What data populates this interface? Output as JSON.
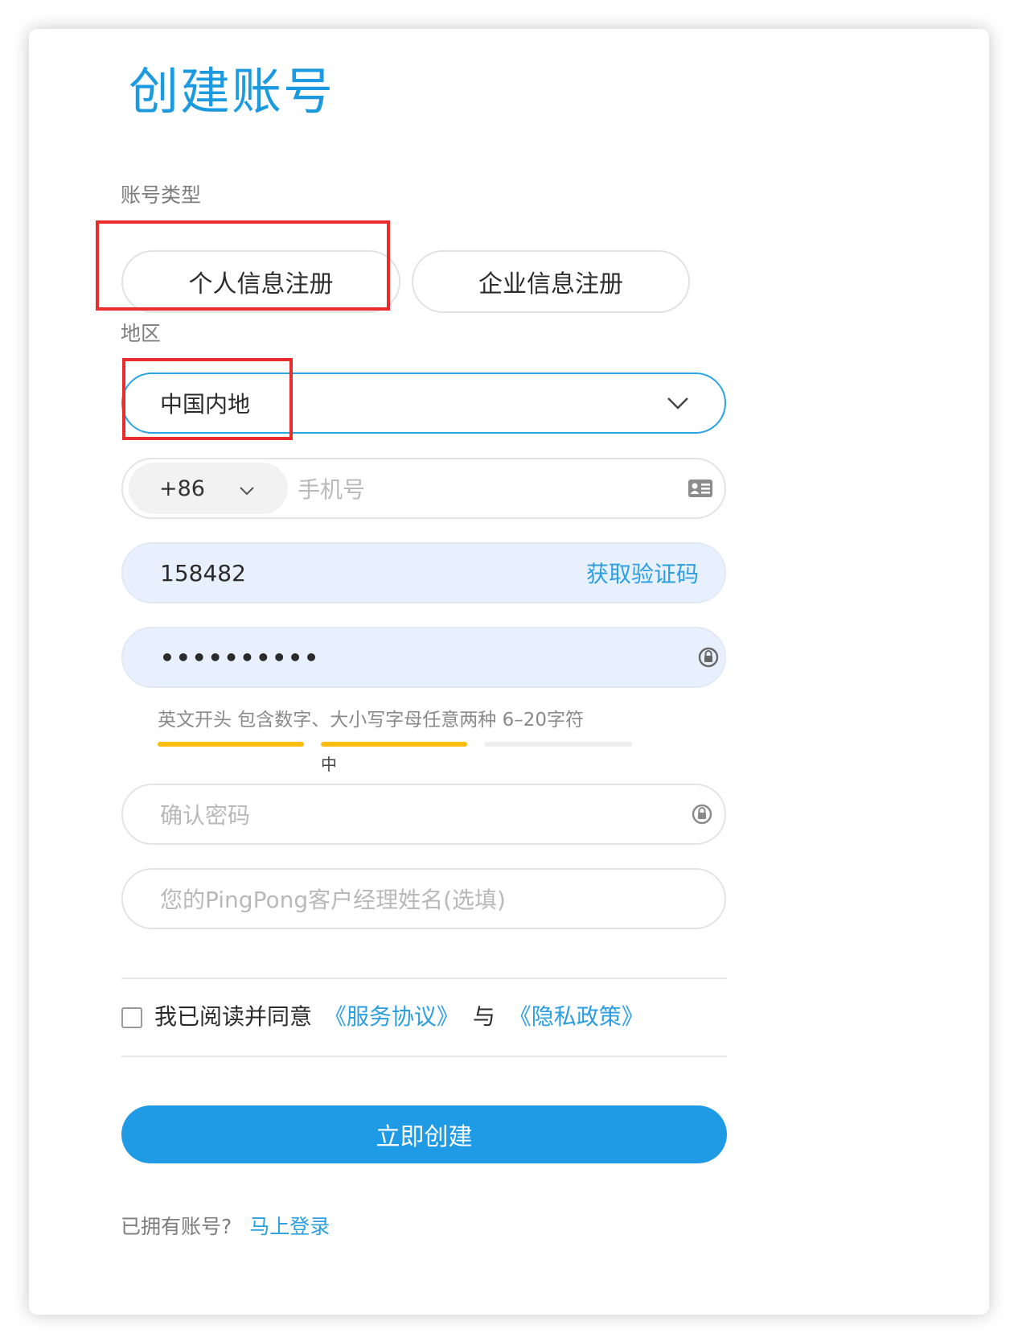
{
  "title": "创建账号",
  "account_type": {
    "label": "账号类型",
    "options": [
      "个人信息注册",
      "企业信息注册"
    ]
  },
  "region": {
    "label": "地区",
    "value": "中国内地"
  },
  "phone": {
    "country_code": "+86",
    "placeholder": "手机号"
  },
  "verification": {
    "value": "158482",
    "get_code_label": "获取验证码"
  },
  "password": {
    "masked_value": "••••••••••",
    "hint": "英文开头 包含数字、大小写字母任意两种 6–20字符",
    "strength_label": "中",
    "strength_level": 2,
    "strength_max": 3
  },
  "confirm_password": {
    "placeholder": "确认密码"
  },
  "manager_name": {
    "placeholder": "您的PingPong客户经理姓名(选填)"
  },
  "agreement": {
    "prefix": "我已阅读并同意",
    "terms": "《服务协议》",
    "conjunction": "与",
    "privacy": "《隐私政策》"
  },
  "submit_label": "立即创建",
  "login": {
    "prompt": "已拥有账号?",
    "link": "马上登录"
  },
  "colors": {
    "accent": "#1f9ae4",
    "strength_on": "#fbbd0d",
    "strength_off": "#eeeeee",
    "annotation": "#ec2b2b"
  }
}
